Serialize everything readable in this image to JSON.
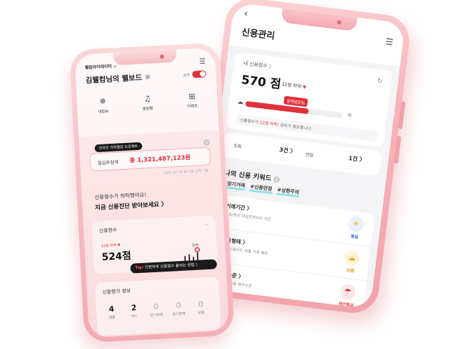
{
  "right_phone": {
    "header": {
      "back_icon": "‹",
      "title": "신용관리",
      "menu_icon": "☰"
    },
    "score_card": {
      "label": "내 신용점수 〉",
      "refresh_icon": "↻",
      "score": "570 점",
      "change": "12점 하락",
      "change_icon": "▼",
      "percentile_badge": "상위65%",
      "bar_fill_percent": 65,
      "note_prefix": "신용점수가 ",
      "note_highlight": "12점 하락",
      "note_suffix": "! 관리가 필요합니다."
    },
    "counts": [
      {
        "label": "조회",
        "value": "3건 〉"
      },
      {
        "label": "연동",
        "value": "1건 〉"
      }
    ],
    "keywords": {
      "title": "나의 신용 키워드",
      "info_icon": "i",
      "tags": [
        "#장기거래",
        "#신용안정",
        "#상환주의"
      ],
      "items": [
        {
          "name": "거래기간 〉",
          "desc": "최초/최근 개설로부터의 기간",
          "status": "좋음",
          "icon": "☀",
          "color": "#3b6fe0",
          "bg": "#e9f0ff"
        },
        {
          "name": "신용형태 〉",
          "desc": "체크/신용카드 대출 거래 패턴",
          "status": "보통",
          "icon": "☁",
          "color": "#f0a020",
          "bg": "#fff3dc"
        },
        {
          "name": "부채수준 〉",
          "desc": "대출 및 보증 채무수준",
          "status": "개선필요",
          "icon": "☂",
          "color": "#e0313a",
          "bg": "#ffe6e7"
        }
      ]
    }
  },
  "left_phone": {
    "brand": "웰컴마이데이터 ⌵",
    "menu_icon": "☰",
    "title": "김웰컴님의 웰보드 ☼",
    "toggle_label": "공개",
    "quick_menu": [
      {
        "icon": "⛯",
        "label": "내정보"
      },
      {
        "icon": "♫",
        "label": "알림함"
      },
      {
        "icon": "⊞",
        "label": "이벤트"
      }
    ],
    "promo": {
      "badge": "전국민 이자절감 프로젝트",
      "close_icon": "×",
      "label": "절감추정액",
      "amount": "총 1,321,487,123원",
      "date": "2021.07.15 총 이용 금액 기준"
    },
    "message_line1": "신용점수가 하락했어요!",
    "message_line2": "지금 신용진단 받아보세요 〉",
    "credit_card": {
      "title": "신용점수",
      "chevron": "⌵",
      "change": "12점 하락 ▼",
      "score": "524점",
      "spark_label": "현재"
    },
    "tip": {
      "prefix": "Tip!",
      "text": " 간편하게 신용점수 올리는 방법 〉"
    },
    "eval": {
      "title": "신용평가 정보",
      "items": [
        {
          "value": "4",
          "label": "대출"
        },
        {
          "value": "2",
          "label": "카드"
        },
        {
          "value": "0",
          "label": "단기연체"
        },
        {
          "value": "0",
          "label": "장기연체"
        },
        {
          "value": "0",
          "label": "보증"
        }
      ]
    }
  }
}
